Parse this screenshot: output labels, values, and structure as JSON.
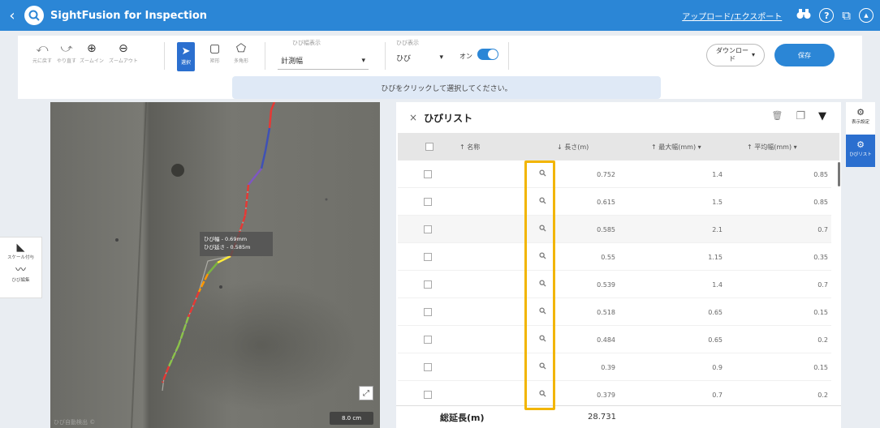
{
  "header": {
    "back_glyph": "‹",
    "logo_icon": "search-icon",
    "title": "SightFusion for Inspection",
    "upload_export_link": "アップロード/エクスポート",
    "help_glyph": "?",
    "external_glyph": "⧉",
    "user_glyph": "▲",
    "binoculars_glyph": "⛯",
    "color": "#2b86d6"
  },
  "toolbar": {
    "undo": {
      "glyph": "⤺",
      "label": "元に戻す"
    },
    "redo": {
      "glyph": "⤻",
      "label": "やり直す"
    },
    "zoom_in": {
      "glyph": "⊕",
      "label": "ズームイン"
    },
    "zoom_out": {
      "glyph": "⊖",
      "label": "ズームアウト"
    },
    "select": {
      "glyph": "➤",
      "label": "選択"
    },
    "rect": {
      "glyph": "▢",
      "label": "矩形"
    },
    "polygon": {
      "glyph": "⬠",
      "label": "多角形"
    },
    "width_display_label": "ひび幅表示",
    "width_display_value": "計測幅",
    "crack_display_label": "ひび表示",
    "crack_display_value": "ひび",
    "toggle_label": "オン",
    "toggle_on": true,
    "download_label": "ダウンロード",
    "save_label": "保存",
    "dropdown_glyph": "▾"
  },
  "banner": {
    "text": "ひびをクリックして選択してください。"
  },
  "left_panel": {
    "scale": {
      "glyph": "◣",
      "label": "スケール付与"
    },
    "edit": {
      "glyph": "〰",
      "label": "ひび編集"
    }
  },
  "viewer": {
    "tooltip_line1": "ひび幅 - 0.69mm",
    "tooltip_line2": "ひび延さ - 0.585m",
    "scale_label": "8.0 cm",
    "expand_glyph": "⤢",
    "footer_text": "ひび自動検出 ©"
  },
  "crack_list": {
    "close_glyph": "×",
    "title": "ひびリスト",
    "delete_glyph": "🗑",
    "copy_glyph": "❐",
    "filter_glyph": "▼",
    "columns": {
      "name": "↑ 名称",
      "length": "↓ 長さ(m)",
      "max_width": "↑ 最大幅(mm) ▾",
      "avg_width": "↑ 平均幅(mm) ▾"
    },
    "rows": [
      {
        "length": "0.752",
        "max_width": "1.4",
        "avg_width": "0.85"
      },
      {
        "length": "0.615",
        "max_width": "1.5",
        "avg_width": "0.85"
      },
      {
        "length": "0.585",
        "max_width": "2.1",
        "avg_width": "0.7"
      },
      {
        "length": "0.55",
        "max_width": "1.15",
        "avg_width": "0.35"
      },
      {
        "length": "0.539",
        "max_width": "1.4",
        "avg_width": "0.7"
      },
      {
        "length": "0.518",
        "max_width": "0.65",
        "avg_width": "0.15"
      },
      {
        "length": "0.484",
        "max_width": "0.65",
        "avg_width": "0.2"
      },
      {
        "length": "0.39",
        "max_width": "0.9",
        "avg_width": "0.15"
      },
      {
        "length": "0.379",
        "max_width": "0.7",
        "avg_width": "0.2"
      }
    ],
    "total_label": "総延長(m)",
    "total_value": "28.731",
    "highlight_color": "#f2b500"
  },
  "side_tabs": {
    "display_settings": {
      "glyph": "⚙",
      "label": "表示設定"
    },
    "crack_list": {
      "glyph": "⚙",
      "label": "ひびリスト"
    }
  }
}
